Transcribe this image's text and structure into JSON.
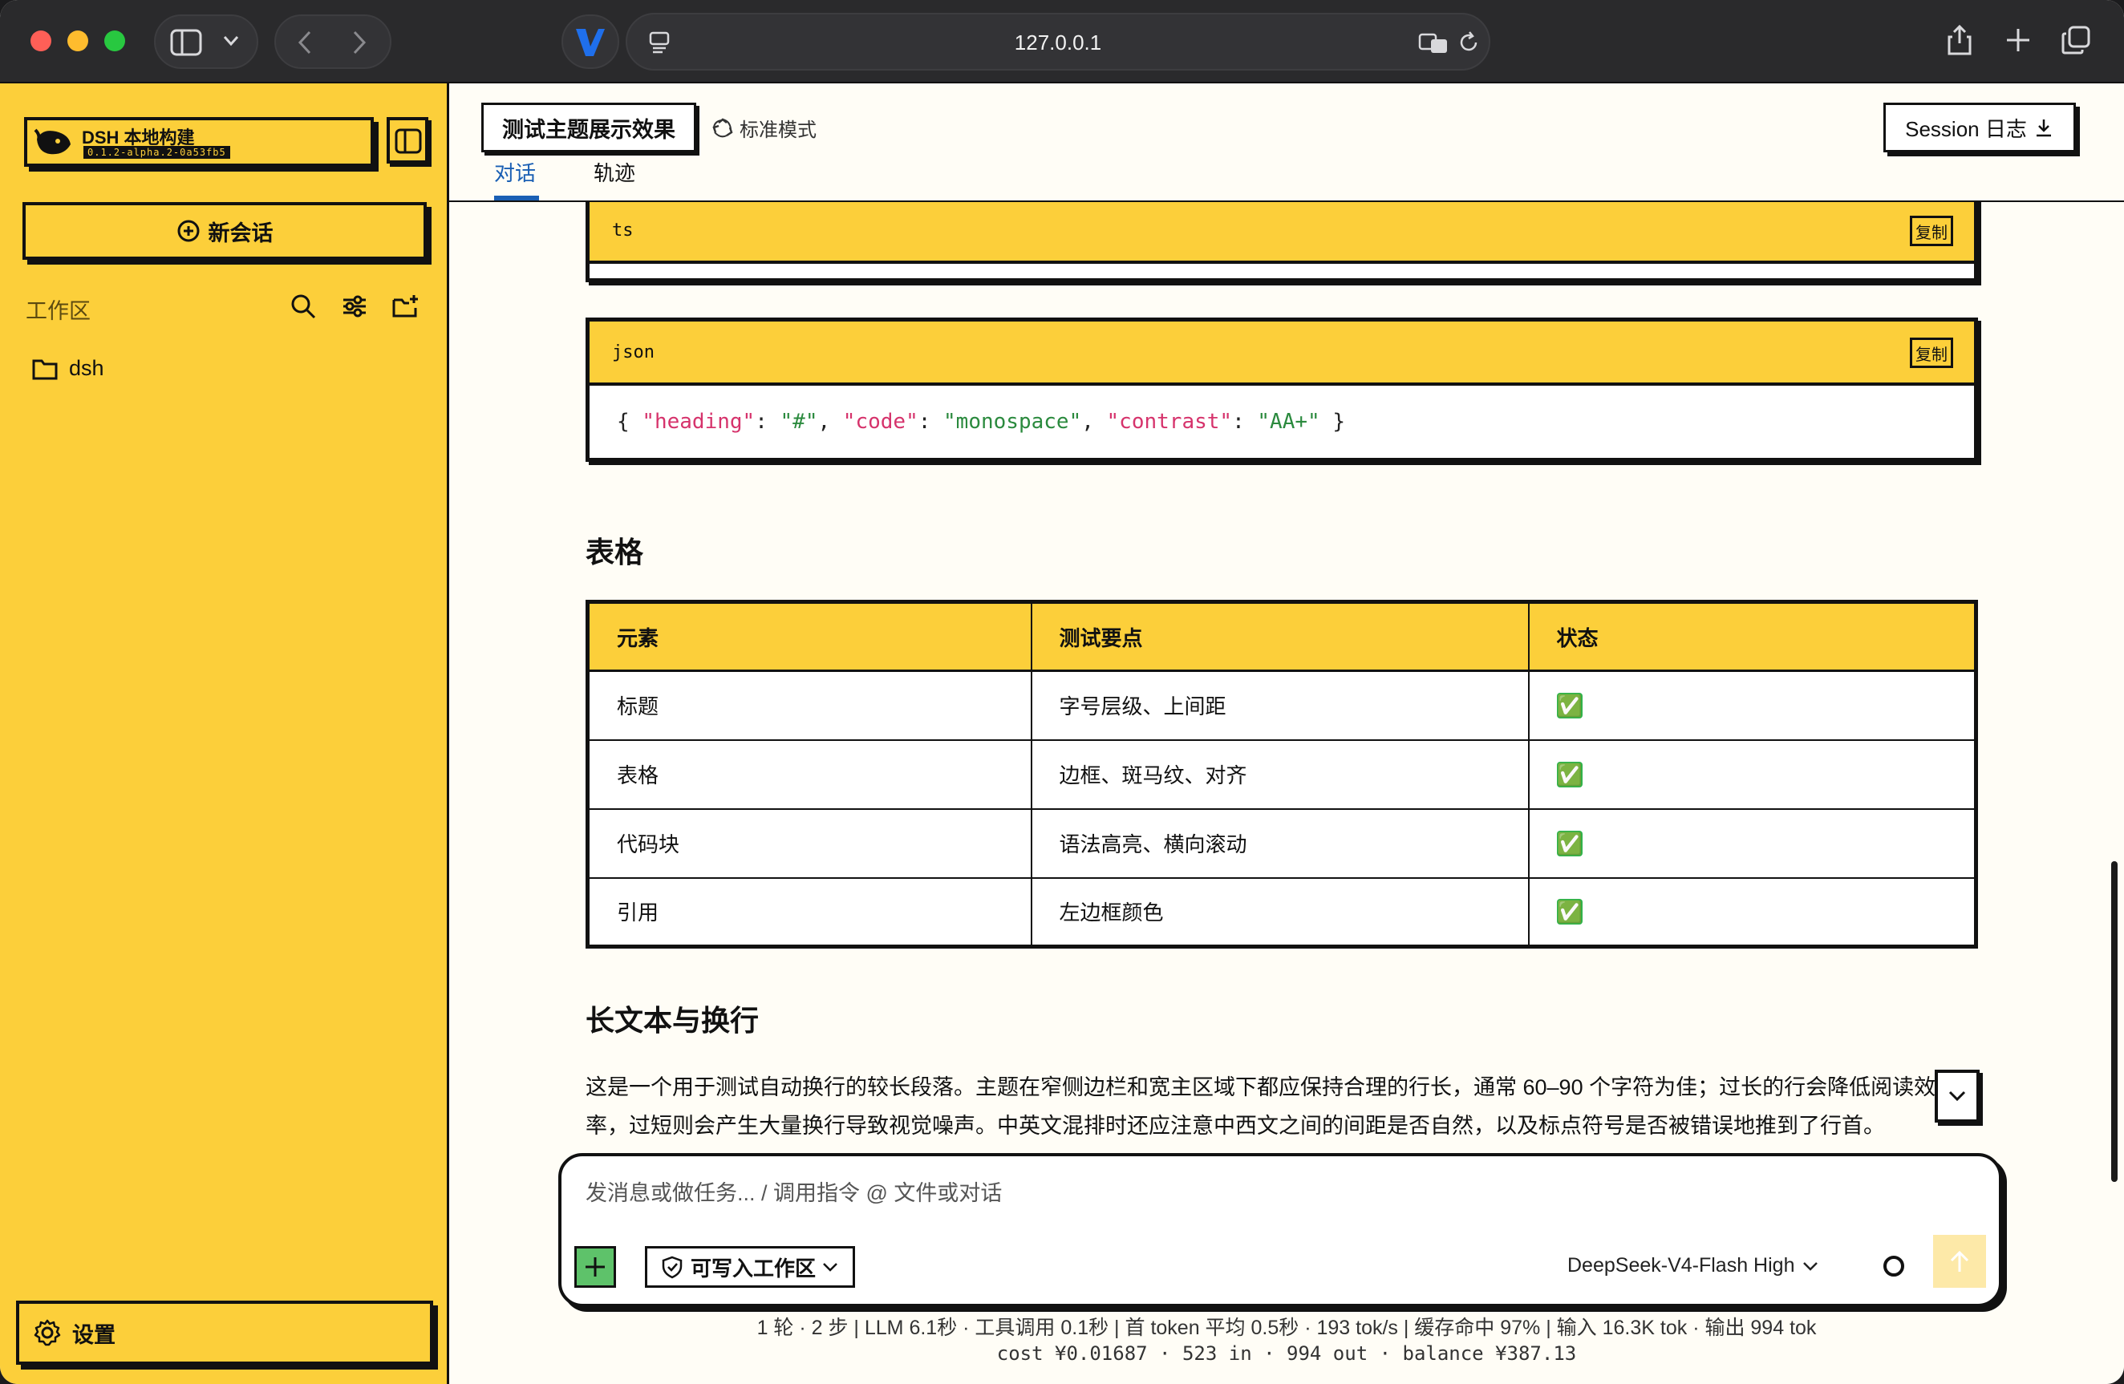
{
  "browser": {
    "url": "127.0.0.1",
    "traffic_lights": {
      "close": "#ff5f57",
      "minimize": "#febc2e",
      "zoom": "#28c840"
    }
  },
  "sidebar": {
    "brand_name": "DSH 本地构建",
    "brand_version": "0.1.2-alpha.2-0a53fb5",
    "new_chat_label": "新会话",
    "workspace_label": "工作区",
    "folders": [
      {
        "name": "dsh",
        "icon": "folder-icon"
      }
    ],
    "settings_label": "设置",
    "accent": "#fccf3a"
  },
  "header": {
    "session_title": "测试主题展示效果",
    "mode_label": "标准模式",
    "tabs": [
      {
        "label": "对话",
        "active": true
      },
      {
        "label": "轨迹",
        "active": false
      }
    ],
    "session_log_label": "Session 日志",
    "active_tab_color": "#1a5fb4"
  },
  "content": {
    "code_blocks": [
      {
        "lang": "ts",
        "copy_label": "复制",
        "code": ""
      },
      {
        "lang": "json",
        "copy_label": "复制",
        "code": "{ \"heading\": \"#\", \"code\": \"monospace\", \"contrast\": \"AA+\" }"
      }
    ],
    "table_heading": "表格",
    "table": {
      "headers": [
        "元素",
        "测试要点",
        "状态"
      ],
      "rows": [
        [
          "标题",
          "字号层级、上间距",
          "✅"
        ],
        [
          "表格",
          "边框、斑马纹、对齐",
          "✅"
        ],
        [
          "代码块",
          "语法高亮、横向滚动",
          "✅"
        ],
        [
          "引用",
          "左边框颜色",
          "✅"
        ]
      ]
    },
    "long_text_heading": "长文本与换行",
    "long_paragraph": "这是一个用于测试自动换行的较长段落。主题在窄侧边栏和宽主区域下都应保持合理的行长，通常 60–90 个字符为佳；过长的行会降低阅读效率，过短则会产生大量换行导致视觉噪声。中英文混排时还应注意中西文之间的间距是否自然，以及标点符号是否被错误地推到了行首。"
  },
  "composer": {
    "placeholder": "发消息或做任务... / 调用指令 @ 文件或对话",
    "permission_label": "可写入工作区",
    "model_label": "DeepSeek-V4-Flash High"
  },
  "stats": {
    "line1": "1 轮 · 2 步  |  LLM 6.1秒 · 工具调用 0.1秒  |  首 token 平均 0.5秒 · 193 tok/s  |  缓存命中 97%  |  输入 16.3K tok · 输出 994 tok",
    "line2": "cost ¥0.01687 · 523 in · 994 out · balance ¥387.13"
  }
}
